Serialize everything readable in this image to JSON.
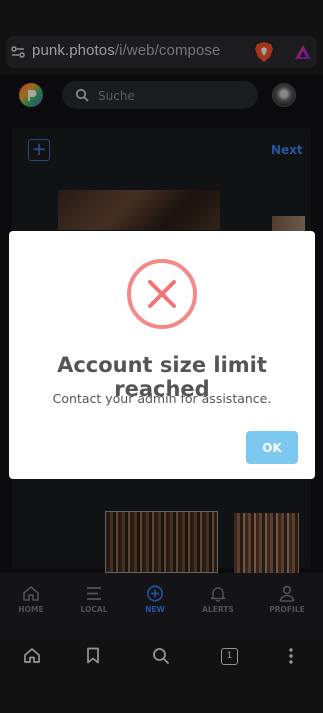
{
  "browser": {
    "url_host": "punk.photos",
    "url_path": "/i/web/compose",
    "tab_count": "1",
    "bottom_icons": [
      "home-icon",
      "bookmark-icon",
      "search-icon",
      "tabs-icon",
      "more-icon"
    ]
  },
  "header": {
    "search_placeholder": "Suche"
  },
  "compose": {
    "next_label": "Next",
    "add_symbol": "+"
  },
  "nav": {
    "items": [
      {
        "label": "HOME",
        "icon": "home-icon"
      },
      {
        "label": "LOCAL",
        "icon": "menu-icon"
      },
      {
        "label": "NEW",
        "icon": "plus-circle-icon",
        "active": true
      },
      {
        "label": "ALERTS",
        "icon": "bell-icon"
      },
      {
        "label": "PROFILE",
        "icon": "user-icon"
      }
    ]
  },
  "modal": {
    "title": "Account size limit reached",
    "message": "Contact your admin for assistance.",
    "ok_label": "OK",
    "icon": "error-x-icon",
    "error_color": "#f27474",
    "button_color": "#7cc8f0"
  },
  "colors": {
    "accent": "#3b82f6",
    "background": "#111214"
  }
}
